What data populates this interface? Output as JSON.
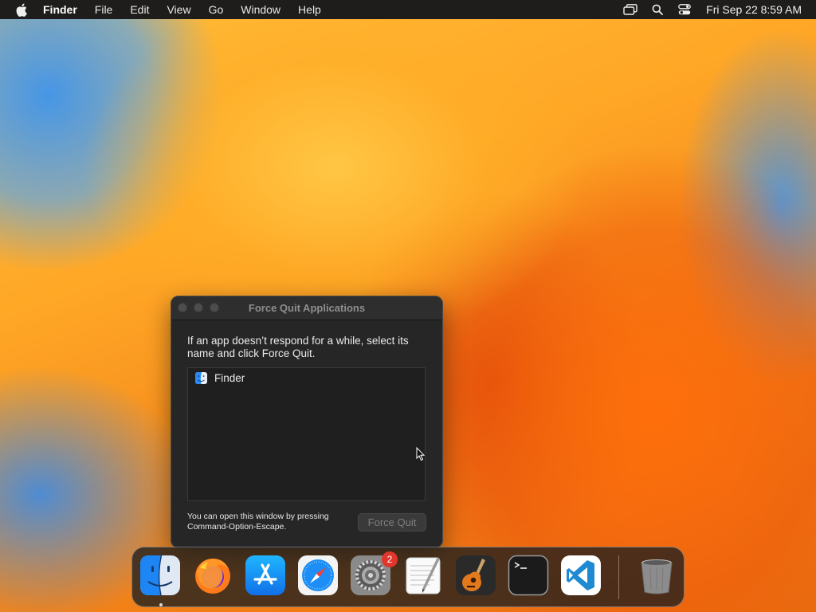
{
  "menubar": {
    "app_name": "Finder",
    "items": [
      "File",
      "Edit",
      "View",
      "Go",
      "Window",
      "Help"
    ],
    "clock": "Fri Sep 22  8:59 AM",
    "status_icons": [
      "screen-mirroring-icon",
      "spotlight-search-icon",
      "control-center-icon"
    ]
  },
  "force_quit": {
    "title": "Force Quit Applications",
    "instructions": "If an app doesn’t respond for a while, select its name and click Force Quit.",
    "apps": [
      "Finder"
    ],
    "footnote": "You can open this window by pressing Command-Option-Escape.",
    "button_label": "Force Quit"
  },
  "dock": {
    "apps": [
      "Finder",
      "Firefox",
      "App Store",
      "Safari",
      "System Settings",
      "TextEdit",
      "GarageBand",
      "Terminal",
      "Visual Studio Code",
      "Trash"
    ],
    "system_settings_badge": "2"
  },
  "colors": {
    "menubar_bg": "#1e1d1c",
    "window_bg": "#262626",
    "badge_red": "#e0362b",
    "wallpaper_orange": "#f39a1a"
  }
}
